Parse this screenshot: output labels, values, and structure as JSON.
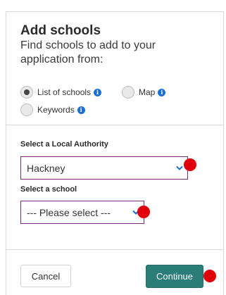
{
  "dialog": {
    "title": "Add schools",
    "subtitle": "Find schools to add to your application from:"
  },
  "search_mode": {
    "options": [
      {
        "label": "List of schools",
        "selected": true
      },
      {
        "label": "Map",
        "selected": false
      },
      {
        "label": "Keywords",
        "selected": false
      }
    ],
    "info_icon": "i"
  },
  "local_authority": {
    "label": "Select a Local Authority",
    "value": "Hackney"
  },
  "school": {
    "label": "Select a school",
    "value": "--- Please select ---"
  },
  "actions": {
    "cancel_label": "Cancel",
    "continue_label": "Continue"
  },
  "colors": {
    "accent": "#2a7d79",
    "select_border": "#7b2d7a",
    "info": "#1a6fd1",
    "marker": "#e0000b"
  }
}
